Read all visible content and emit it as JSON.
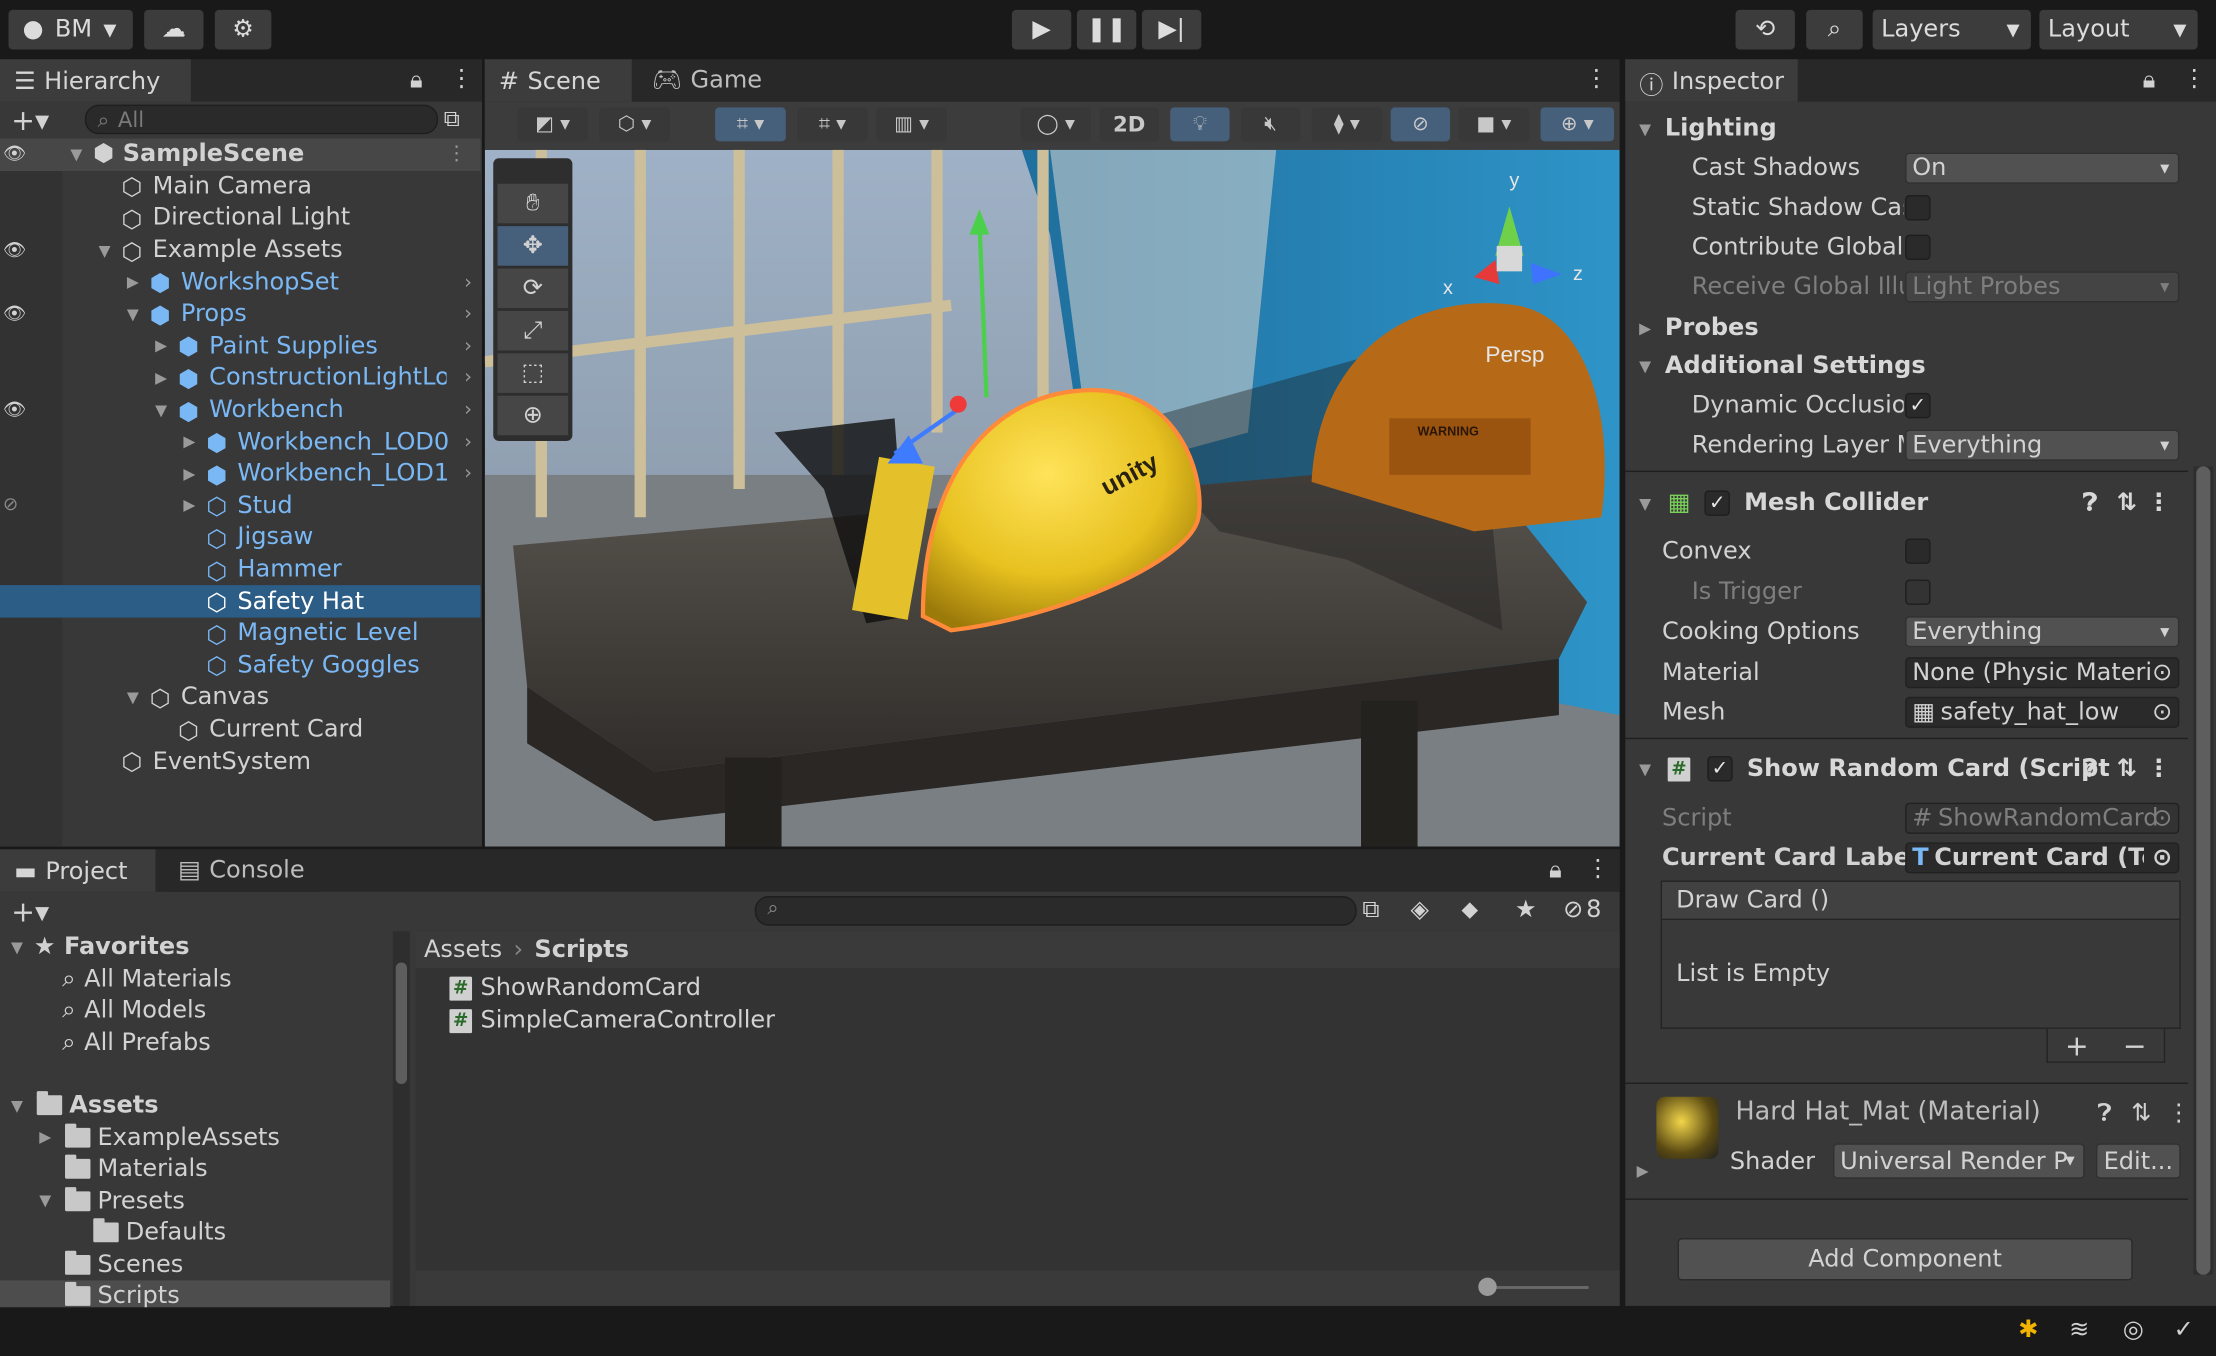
{
  "topbar": {
    "account": "BM",
    "layers": "Layers",
    "layout": "Layout"
  },
  "hierarchy": {
    "tab": "Hierarchy",
    "search_placeholder": "All",
    "items": [
      {
        "label": "SampleScene"
      },
      {
        "label": "Main Camera"
      },
      {
        "label": "Directional Light"
      },
      {
        "label": "Example Assets"
      },
      {
        "label": "WorkshopSet"
      },
      {
        "label": "Props"
      },
      {
        "label": "Paint Supplies"
      },
      {
        "label": "ConstructionLightLow"
      },
      {
        "label": "Workbench"
      },
      {
        "label": "Workbench_LOD0"
      },
      {
        "label": "Workbench_LOD1"
      },
      {
        "label": "Stud"
      },
      {
        "label": "Jigsaw"
      },
      {
        "label": "Hammer"
      },
      {
        "label": "Safety Hat"
      },
      {
        "label": "Magnetic Level"
      },
      {
        "label": "Safety Goggles"
      },
      {
        "label": "Canvas"
      },
      {
        "label": "Current Card"
      },
      {
        "label": "EventSystem"
      }
    ]
  },
  "scene": {
    "tab_scene": "Scene",
    "tab_game": "Game",
    "btn_2d": "2D",
    "persp": "Persp",
    "axis_x": "x",
    "axis_y": "y",
    "axis_z": "z",
    "hat_logo": "unity",
    "saw_label": "WARNING"
  },
  "project": {
    "tab_project": "Project",
    "tab_console": "Console",
    "hidden_count": "8",
    "favorites": "Favorites",
    "fav_items": [
      "All Materials",
      "All Models",
      "All Prefabs"
    ],
    "assets": "Assets",
    "folders": [
      "ExampleAssets",
      "Materials",
      "Presets",
      "Defaults",
      "Scenes",
      "Scripts"
    ],
    "breadcrumb_root": "Assets",
    "breadcrumb_current": "Scripts",
    "files": [
      "ShowRandomCard",
      "SimpleCameraController"
    ]
  },
  "inspector": {
    "tab": "Inspector",
    "lighting": "Lighting",
    "cast_shadows": "Cast Shadows",
    "cast_shadows_val": "On",
    "static_shadow": "Static Shadow Cas",
    "contribute_gi": "Contribute Global I",
    "receive_gi": "Receive Global Illu",
    "receive_gi_val": "Light Probes",
    "probes": "Probes",
    "additional": "Additional Settings",
    "dyn_occ": "Dynamic Occlusion",
    "render_layer": "Rendering Layer M",
    "render_layer_val": "Everything",
    "mesh_collider": "Mesh Collider",
    "convex": "Convex",
    "is_trigger": "Is Trigger",
    "cooking": "Cooking Options",
    "cooking_val": "Everything",
    "material": "Material",
    "material_val": "None (Physic Materia",
    "mesh": "Mesh",
    "mesh_val": "safety_hat_low",
    "script_comp": "Show Random Card (Script",
    "script": "Script",
    "script_val": "ShowRandomCard",
    "card_label": "Current Card Label",
    "card_label_val": "Current Card (Te",
    "draw_card": "Draw Card ()",
    "list_empty": "List is Empty",
    "mat_name": "Hard Hat_Mat (Material)",
    "shader": "Shader",
    "shader_val": "Universal Render P",
    "edit": "Edit...",
    "add_component": "Add Component"
  },
  "colors": {
    "accent": "#46607c",
    "selection": "#2c5d87",
    "prefab_blue": "#7ab8f5"
  }
}
